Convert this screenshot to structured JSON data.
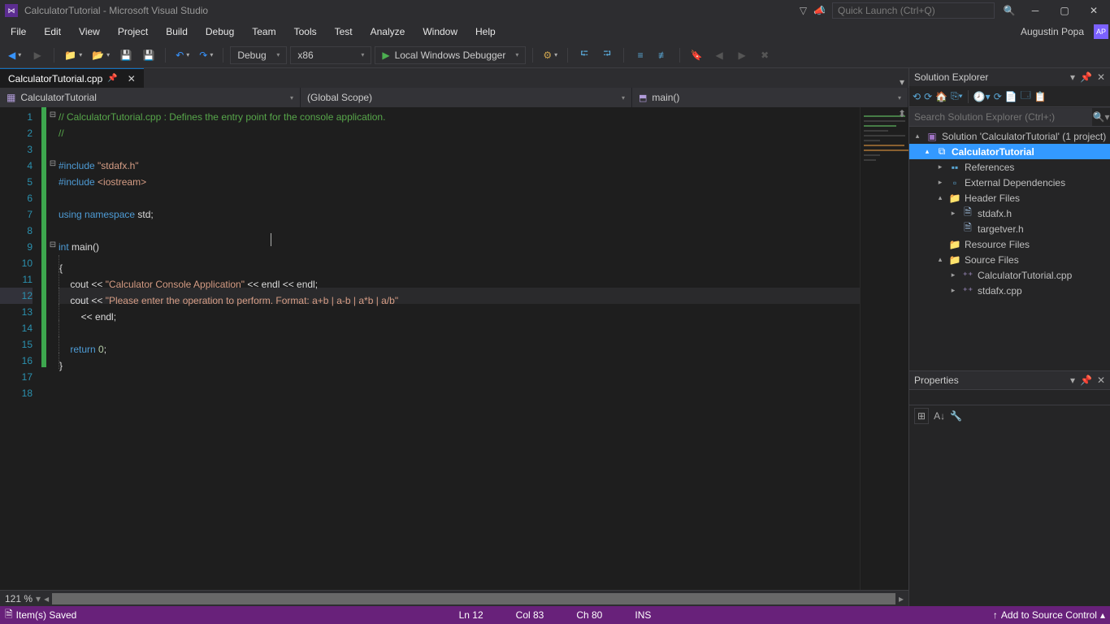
{
  "title": "CalculatorTutorial - Microsoft Visual Studio",
  "quicklaunch": {
    "placeholder": "Quick Launch (Ctrl+Q)"
  },
  "menu": [
    "File",
    "Edit",
    "View",
    "Project",
    "Build",
    "Debug",
    "Team",
    "Tools",
    "Test",
    "Analyze",
    "Window",
    "Help"
  ],
  "user": {
    "name": "Augustin Popa",
    "initials": "AP"
  },
  "toolbar": {
    "config": "Debug",
    "platform": "x86",
    "start": "Local Windows Debugger"
  },
  "tab": {
    "name": "CalculatorTutorial.cpp"
  },
  "navbar": {
    "class": "CalculatorTutorial",
    "scope": "(Global Scope)",
    "func": "main()"
  },
  "code": {
    "lines": [
      {
        "n": 1,
        "fold": "⊟",
        "tokens": [
          {
            "t": "// CalculatorTutorial.cpp : Defines the entry point for the console application.",
            "c": "cm"
          }
        ]
      },
      {
        "n": 2,
        "tokens": [
          {
            "t": "//",
            "c": "cm"
          }
        ]
      },
      {
        "n": 3,
        "tokens": []
      },
      {
        "n": 4,
        "fold": "⊟",
        "tokens": [
          {
            "t": "#include ",
            "c": "k"
          },
          {
            "t": "\"stdafx.h\"",
            "c": "str"
          }
        ]
      },
      {
        "n": 5,
        "tokens": [
          {
            "t": "#include ",
            "c": "k"
          },
          {
            "t": "<iostream>",
            "c": "str"
          }
        ]
      },
      {
        "n": 6,
        "tokens": []
      },
      {
        "n": 7,
        "tokens": [
          {
            "t": "using",
            "c": "k"
          },
          {
            "t": " "
          },
          {
            "t": "namespace",
            "c": "k"
          },
          {
            "t": " std;"
          }
        ]
      },
      {
        "n": 8,
        "tokens": []
      },
      {
        "n": 9,
        "fold": "⊟",
        "tokens": [
          {
            "t": "int",
            "c": "k"
          },
          {
            "t": " main()"
          }
        ]
      },
      {
        "n": 10,
        "tokens": [
          {
            "t": "{"
          }
        ]
      },
      {
        "n": 11,
        "indent": 1,
        "tokens": [
          {
            "t": "cout << "
          },
          {
            "t": "\"Calculator Console Application\"",
            "c": "str"
          },
          {
            "t": " << endl << endl;"
          }
        ]
      },
      {
        "n": 12,
        "indent": 1,
        "hl": true,
        "tokens": [
          {
            "t": "cout << "
          },
          {
            "t": "\"Please enter the operation to perform. Format: a+b | a-b | a*b | a/b\"",
            "c": "str"
          }
        ]
      },
      {
        "n": 13,
        "indent": 2,
        "tokens": [
          {
            "t": "<< endl;"
          }
        ]
      },
      {
        "n": 14,
        "tokens": []
      },
      {
        "n": 15,
        "indent": 1,
        "tokens": [
          {
            "t": "return",
            "c": "k"
          },
          {
            "t": " "
          },
          {
            "t": "0",
            "c": "num"
          },
          {
            "t": ";"
          }
        ]
      },
      {
        "n": 16,
        "tokens": [
          {
            "t": "}"
          }
        ]
      },
      {
        "n": 17,
        "tokens": []
      },
      {
        "n": 18,
        "tokens": []
      }
    ]
  },
  "zoom": "121 %",
  "solution_explorer": {
    "title": "Solution Explorer",
    "search_placeholder": "Search Solution Explorer (Ctrl+;)",
    "solution": "Solution 'CalculatorTutorial' (1 project)",
    "project": "CalculatorTutorial",
    "nodes": {
      "references": "References",
      "external": "External Dependencies",
      "headers": "Header Files",
      "h1": "stdafx.h",
      "h2": "targetver.h",
      "resources": "Resource Files",
      "sources": "Source Files",
      "s1": "CalculatorTutorial.cpp",
      "s2": "stdafx.cpp"
    }
  },
  "properties": {
    "title": "Properties"
  },
  "status": {
    "saved": "Item(s) Saved",
    "ln": "Ln 12",
    "col": "Col 83",
    "ch": "Ch 80",
    "ins": "INS",
    "scc": "Add to Source Control"
  }
}
